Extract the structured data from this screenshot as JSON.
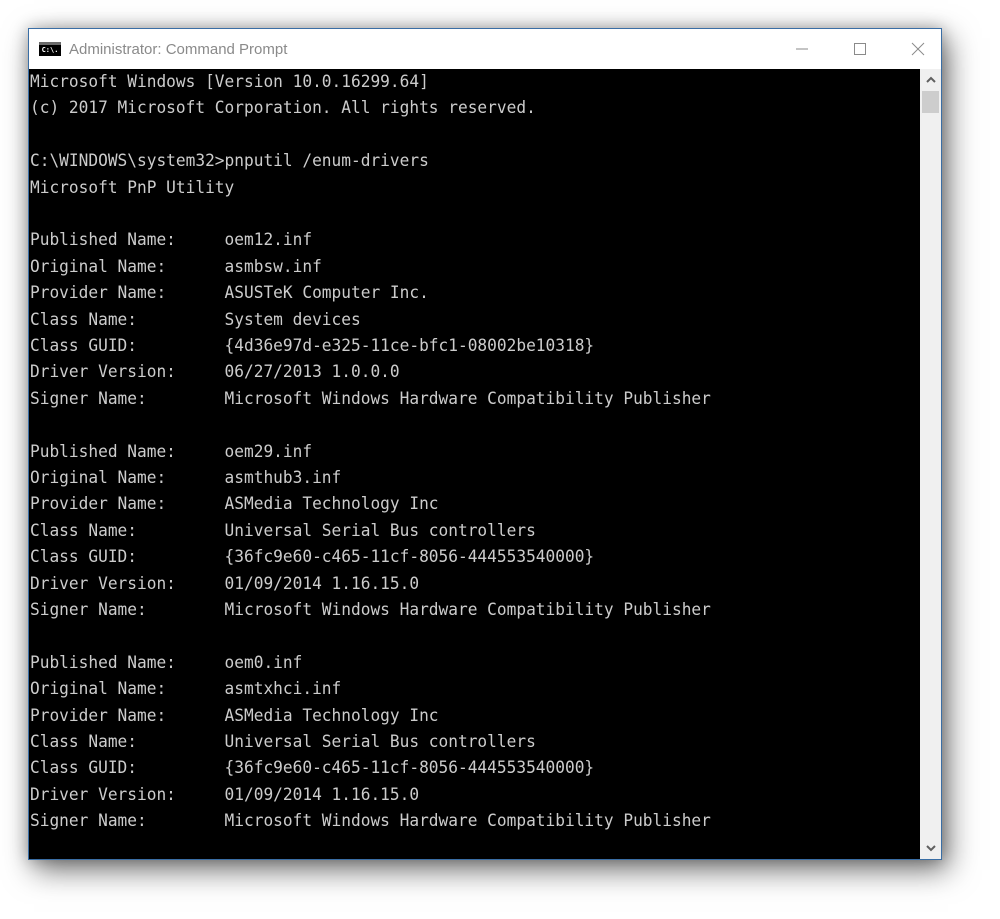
{
  "window": {
    "title": "Administrator: Command Prompt",
    "icon": "cmd-icon",
    "icon_text": "C:\\.",
    "controls": {
      "minimize": "minimize-icon",
      "maximize": "maximize-icon",
      "close": "close-icon"
    }
  },
  "console": {
    "lines": [
      "Microsoft Windows [Version 10.0.16299.64]",
      "(c) 2017 Microsoft Corporation. All rights reserved.",
      "",
      "C:\\WINDOWS\\system32>pnputil /enum-drivers",
      "Microsoft PnP Utility",
      "",
      "Published Name:     oem12.inf",
      "Original Name:      asmbsw.inf",
      "Provider Name:      ASUSTeK Computer Inc.",
      "Class Name:         System devices",
      "Class GUID:         {4d36e97d-e325-11ce-bfc1-08002be10318}",
      "Driver Version:     06/27/2013 1.0.0.0",
      "Signer Name:        Microsoft Windows Hardware Compatibility Publisher",
      "",
      "Published Name:     oem29.inf",
      "Original Name:      asmthub3.inf",
      "Provider Name:      ASMedia Technology Inc",
      "Class Name:         Universal Serial Bus controllers",
      "Class GUID:         {36fc9e60-c465-11cf-8056-444553540000}",
      "Driver Version:     01/09/2014 1.16.15.0",
      "Signer Name:        Microsoft Windows Hardware Compatibility Publisher",
      "",
      "Published Name:     oem0.inf",
      "Original Name:      asmtxhci.inf",
      "Provider Name:      ASMedia Technology Inc",
      "Class Name:         Universal Serial Bus controllers",
      "Class GUID:         {36fc9e60-c465-11cf-8056-444553540000}",
      "Driver Version:     01/09/2014 1.16.15.0",
      "Signer Name:        Microsoft Windows Hardware Compatibility Publisher"
    ],
    "drivers": [
      {
        "published_name": "oem12.inf",
        "original_name": "asmbsw.inf",
        "provider_name": "ASUSTeK Computer Inc.",
        "class_name": "System devices",
        "class_guid": "{4d36e97d-e325-11ce-bfc1-08002be10318}",
        "driver_version": "06/27/2013 1.0.0.0",
        "signer_name": "Microsoft Windows Hardware Compatibility Publisher"
      },
      {
        "published_name": "oem29.inf",
        "original_name": "asmthub3.inf",
        "provider_name": "ASMedia Technology Inc",
        "class_name": "Universal Serial Bus controllers",
        "class_guid": "{36fc9e60-c465-11cf-8056-444553540000}",
        "driver_version": "01/09/2014 1.16.15.0",
        "signer_name": "Microsoft Windows Hardware Compatibility Publisher"
      },
      {
        "published_name": "oem0.inf",
        "original_name": "asmtxhci.inf",
        "provider_name": "ASMedia Technology Inc",
        "class_name": "Universal Serial Bus controllers",
        "class_guid": "{36fc9e60-c465-11cf-8056-444553540000}",
        "driver_version": "01/09/2014 1.16.15.0",
        "signer_name": "Microsoft Windows Hardware Compatibility Publisher"
      }
    ]
  },
  "scrollbar": {
    "up": "scroll-up-arrow-icon",
    "down": "scroll-down-arrow-icon"
  },
  "colors": {
    "console_bg": "#000000",
    "console_fg": "#cccccc",
    "titlebar_bg": "#ffffff",
    "title_fg": "#8a8a8a",
    "border": "#3a6ea5"
  }
}
